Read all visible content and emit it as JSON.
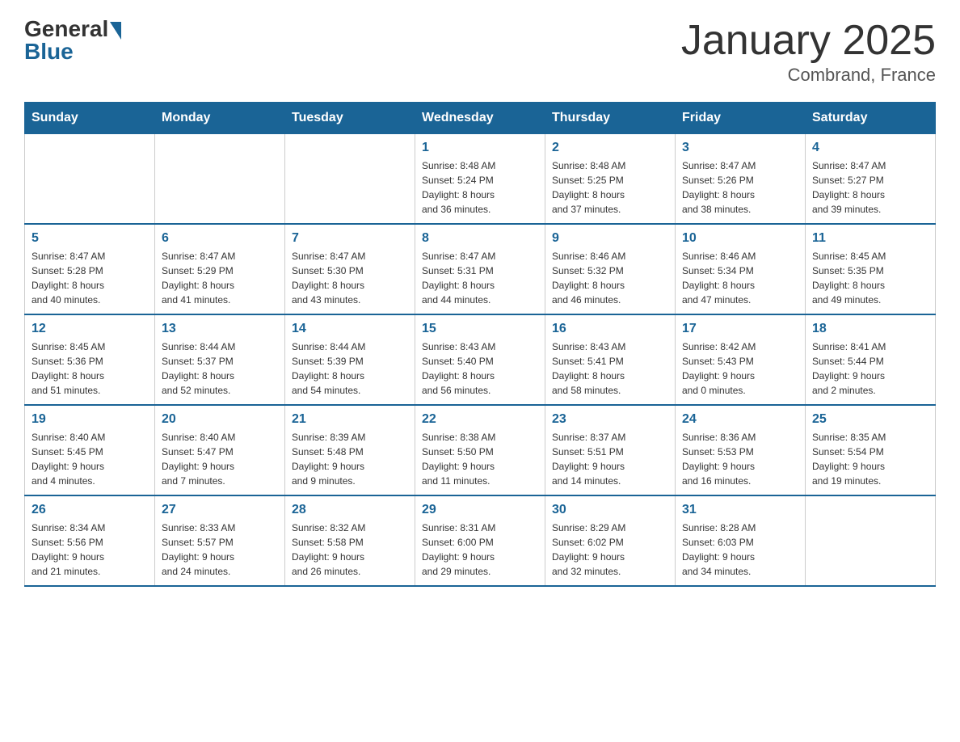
{
  "header": {
    "logo_general": "General",
    "logo_blue": "Blue",
    "title": "January 2025",
    "subtitle": "Combrand, France"
  },
  "weekdays": [
    "Sunday",
    "Monday",
    "Tuesday",
    "Wednesday",
    "Thursday",
    "Friday",
    "Saturday"
  ],
  "weeks": [
    [
      {
        "day": "",
        "info": ""
      },
      {
        "day": "",
        "info": ""
      },
      {
        "day": "",
        "info": ""
      },
      {
        "day": "1",
        "info": "Sunrise: 8:48 AM\nSunset: 5:24 PM\nDaylight: 8 hours\nand 36 minutes."
      },
      {
        "day": "2",
        "info": "Sunrise: 8:48 AM\nSunset: 5:25 PM\nDaylight: 8 hours\nand 37 minutes."
      },
      {
        "day": "3",
        "info": "Sunrise: 8:47 AM\nSunset: 5:26 PM\nDaylight: 8 hours\nand 38 minutes."
      },
      {
        "day": "4",
        "info": "Sunrise: 8:47 AM\nSunset: 5:27 PM\nDaylight: 8 hours\nand 39 minutes."
      }
    ],
    [
      {
        "day": "5",
        "info": "Sunrise: 8:47 AM\nSunset: 5:28 PM\nDaylight: 8 hours\nand 40 minutes."
      },
      {
        "day": "6",
        "info": "Sunrise: 8:47 AM\nSunset: 5:29 PM\nDaylight: 8 hours\nand 41 minutes."
      },
      {
        "day": "7",
        "info": "Sunrise: 8:47 AM\nSunset: 5:30 PM\nDaylight: 8 hours\nand 43 minutes."
      },
      {
        "day": "8",
        "info": "Sunrise: 8:47 AM\nSunset: 5:31 PM\nDaylight: 8 hours\nand 44 minutes."
      },
      {
        "day": "9",
        "info": "Sunrise: 8:46 AM\nSunset: 5:32 PM\nDaylight: 8 hours\nand 46 minutes."
      },
      {
        "day": "10",
        "info": "Sunrise: 8:46 AM\nSunset: 5:34 PM\nDaylight: 8 hours\nand 47 minutes."
      },
      {
        "day": "11",
        "info": "Sunrise: 8:45 AM\nSunset: 5:35 PM\nDaylight: 8 hours\nand 49 minutes."
      }
    ],
    [
      {
        "day": "12",
        "info": "Sunrise: 8:45 AM\nSunset: 5:36 PM\nDaylight: 8 hours\nand 51 minutes."
      },
      {
        "day": "13",
        "info": "Sunrise: 8:44 AM\nSunset: 5:37 PM\nDaylight: 8 hours\nand 52 minutes."
      },
      {
        "day": "14",
        "info": "Sunrise: 8:44 AM\nSunset: 5:39 PM\nDaylight: 8 hours\nand 54 minutes."
      },
      {
        "day": "15",
        "info": "Sunrise: 8:43 AM\nSunset: 5:40 PM\nDaylight: 8 hours\nand 56 minutes."
      },
      {
        "day": "16",
        "info": "Sunrise: 8:43 AM\nSunset: 5:41 PM\nDaylight: 8 hours\nand 58 minutes."
      },
      {
        "day": "17",
        "info": "Sunrise: 8:42 AM\nSunset: 5:43 PM\nDaylight: 9 hours\nand 0 minutes."
      },
      {
        "day": "18",
        "info": "Sunrise: 8:41 AM\nSunset: 5:44 PM\nDaylight: 9 hours\nand 2 minutes."
      }
    ],
    [
      {
        "day": "19",
        "info": "Sunrise: 8:40 AM\nSunset: 5:45 PM\nDaylight: 9 hours\nand 4 minutes."
      },
      {
        "day": "20",
        "info": "Sunrise: 8:40 AM\nSunset: 5:47 PM\nDaylight: 9 hours\nand 7 minutes."
      },
      {
        "day": "21",
        "info": "Sunrise: 8:39 AM\nSunset: 5:48 PM\nDaylight: 9 hours\nand 9 minutes."
      },
      {
        "day": "22",
        "info": "Sunrise: 8:38 AM\nSunset: 5:50 PM\nDaylight: 9 hours\nand 11 minutes."
      },
      {
        "day": "23",
        "info": "Sunrise: 8:37 AM\nSunset: 5:51 PM\nDaylight: 9 hours\nand 14 minutes."
      },
      {
        "day": "24",
        "info": "Sunrise: 8:36 AM\nSunset: 5:53 PM\nDaylight: 9 hours\nand 16 minutes."
      },
      {
        "day": "25",
        "info": "Sunrise: 8:35 AM\nSunset: 5:54 PM\nDaylight: 9 hours\nand 19 minutes."
      }
    ],
    [
      {
        "day": "26",
        "info": "Sunrise: 8:34 AM\nSunset: 5:56 PM\nDaylight: 9 hours\nand 21 minutes."
      },
      {
        "day": "27",
        "info": "Sunrise: 8:33 AM\nSunset: 5:57 PM\nDaylight: 9 hours\nand 24 minutes."
      },
      {
        "day": "28",
        "info": "Sunrise: 8:32 AM\nSunset: 5:58 PM\nDaylight: 9 hours\nand 26 minutes."
      },
      {
        "day": "29",
        "info": "Sunrise: 8:31 AM\nSunset: 6:00 PM\nDaylight: 9 hours\nand 29 minutes."
      },
      {
        "day": "30",
        "info": "Sunrise: 8:29 AM\nSunset: 6:02 PM\nDaylight: 9 hours\nand 32 minutes."
      },
      {
        "day": "31",
        "info": "Sunrise: 8:28 AM\nSunset: 6:03 PM\nDaylight: 9 hours\nand 34 minutes."
      },
      {
        "day": "",
        "info": ""
      }
    ]
  ]
}
